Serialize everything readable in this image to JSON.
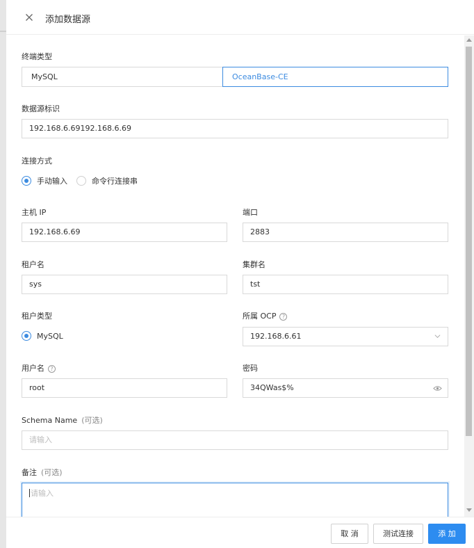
{
  "header": {
    "title": "添加数据源"
  },
  "form": {
    "terminal_type": {
      "label": "终端类型",
      "options": [
        "MySQL",
        "OceanBase-CE"
      ],
      "selected": "OceanBase-CE"
    },
    "datasource_id": {
      "label": "数据源标识",
      "value": "192.168.6.69192.168.6.69"
    },
    "connection_method": {
      "label": "连接方式",
      "options": [
        "手动输入",
        "命令行连接串"
      ],
      "selected": "手动输入"
    },
    "host_ip": {
      "label": "主机 IP",
      "value": "192.168.6.69"
    },
    "port": {
      "label": "端口",
      "value": "2883"
    },
    "tenant_name": {
      "label": "租户名",
      "value": "sys"
    },
    "cluster_name": {
      "label": "集群名",
      "value": "tst"
    },
    "tenant_type": {
      "label": "租户类型",
      "options": [
        "MySQL"
      ],
      "selected": "MySQL"
    },
    "ocp": {
      "label": "所属 OCP",
      "value": "192.168.6.61"
    },
    "username": {
      "label": "用户名",
      "value": "root"
    },
    "password": {
      "label": "密码",
      "value": "34QWas$%"
    },
    "schema_name": {
      "label": "Schema Name",
      "optional": "(可选)",
      "placeholder": "请输入"
    },
    "remark": {
      "label": "备注",
      "optional": "(可选)",
      "placeholder": "请输入"
    }
  },
  "footer": {
    "cancel_label": "取 消",
    "test_label": "测试连接",
    "add_label": "添 加"
  },
  "colors": {
    "accent": "#2d8cf0",
    "border": "#d9d9d9"
  },
  "icons": [
    "close-icon",
    "help-icon",
    "chevron-down-icon",
    "eye-icon"
  ]
}
